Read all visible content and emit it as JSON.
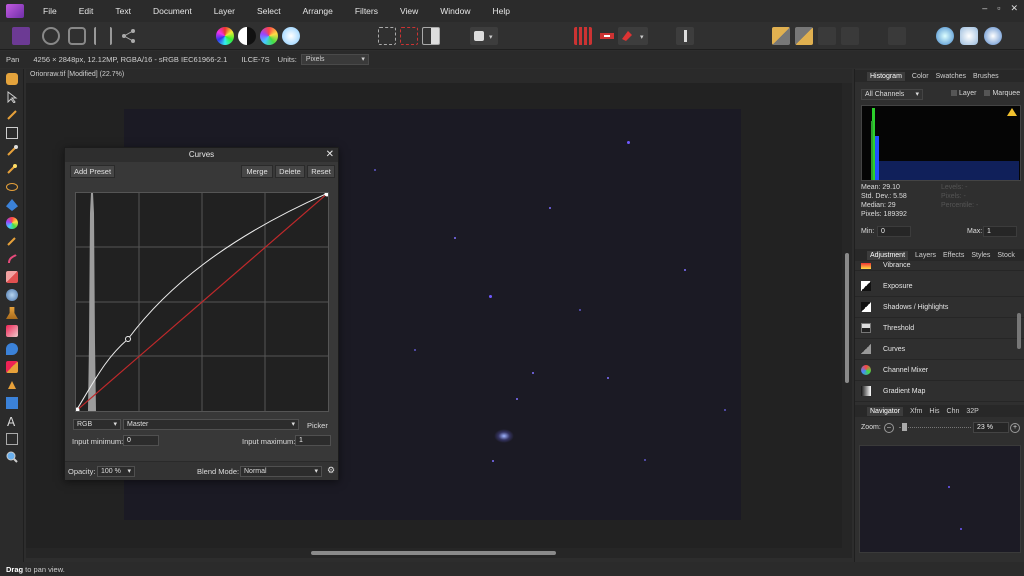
{
  "menu": [
    "File",
    "Edit",
    "Text",
    "Document",
    "Layer",
    "Select",
    "Arrange",
    "Filters",
    "View",
    "Window",
    "Help"
  ],
  "window_controls": [
    "–",
    "▫",
    "✕"
  ],
  "context": {
    "tool_name": "Pan",
    "doc_info": "4256 × 2848px, 12.12MP, RGBA/16 - sRGB IEC61966-2.1",
    "camera": "ILCE-7S",
    "units_label": "Units:",
    "units_value": "Pixels"
  },
  "doc_tab": "Orionraw.tif [Modified] (22.7%)",
  "curves": {
    "title": "Curves",
    "add_preset": "Add Preset",
    "merge": "Merge",
    "delete": "Delete",
    "reset": "Reset",
    "channel": "RGB",
    "mode": "Master",
    "picker": "Picker",
    "input_min_label": "Input minimum:",
    "input_min_value": "0",
    "input_max_label": "Input maximum:",
    "input_max_value": "1",
    "opacity_label": "Opacity:",
    "opacity_value": "100 %",
    "blend_label": "Blend Mode:",
    "blend_value": "Normal"
  },
  "panel_tabs_top": [
    "Histogram",
    "Color",
    "Swatches",
    "Brushes"
  ],
  "histogram": {
    "channel": "All Channels",
    "layer_label": "Layer",
    "marquee_label": "Marquee",
    "mean": "Mean: 29.10",
    "std": "Std. Dev.: 5.58",
    "median": "Median: 29",
    "pixels": "Pixels: 189392",
    "levels": "Levels: -",
    "pixels2": "Pixels: -",
    "percentile": "Percentile: -",
    "min_label": "Min:",
    "min_value": "0",
    "max_label": "Max:",
    "max_value": "1"
  },
  "panel_tabs_mid": [
    "Adjustment",
    "Layers",
    "Effects",
    "Styles",
    "Stock"
  ],
  "adjustments": [
    "Vibrance",
    "Exposure",
    "Shadows / Highlights",
    "Threshold",
    "Curves",
    "Channel Mixer",
    "Gradient Map"
  ],
  "panel_tabs_bottom": [
    "Navigator",
    "Xfm",
    "His",
    "Chn",
    "32P"
  ],
  "navigator": {
    "zoom_label": "Zoom:",
    "zoom_value": "23 %",
    "zoom_out": "–",
    "zoom_in": "+"
  },
  "status": {
    "bold": "Drag",
    "text": " to pan view."
  },
  "accent": "#a44bdc"
}
